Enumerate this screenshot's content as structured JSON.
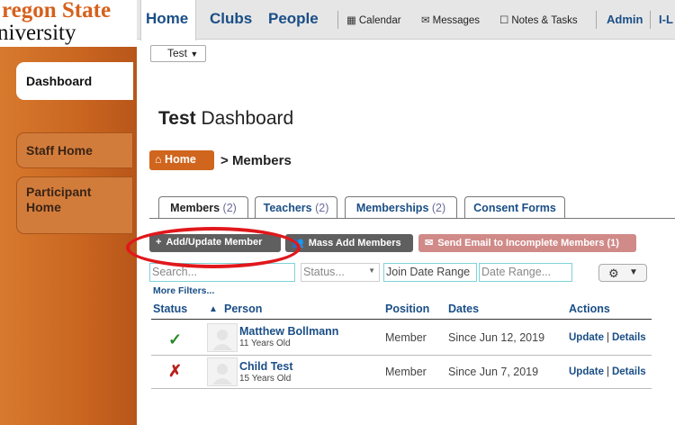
{
  "logo": {
    "line1": "regon State",
    "line2": "niversity"
  },
  "topnav": {
    "home": "Home",
    "clubs": "Clubs",
    "people": "People",
    "calendar": "Calendar",
    "messages": "Messages",
    "notes": "Notes & Tasks",
    "admin": "Admin",
    "overflow": "I-L"
  },
  "sidebar": {
    "items": [
      {
        "label": "Dashboard"
      },
      {
        "label": "Staff Home"
      },
      {
        "label": "Participant Home"
      }
    ]
  },
  "selector": {
    "value": "Test"
  },
  "page": {
    "title_bold": "Test",
    "title_rest": " Dashboard"
  },
  "breadcrumb": {
    "home": "Home",
    "current": "Members"
  },
  "tabs": [
    {
      "label": "Members",
      "count": "(2)"
    },
    {
      "label": "Teachers",
      "count": "(2)"
    },
    {
      "label": "Memberships",
      "count": "(2)"
    },
    {
      "label": "Consent Forms",
      "count": ""
    }
  ],
  "actions": {
    "add_update": "Add/Update Member",
    "mass_add": "Mass Add Members",
    "send_email": "Send Email to Incomplete Members (1)"
  },
  "filters": {
    "search_placeholder": "Search...",
    "status_placeholder": "Status...",
    "join_date_range": "Join Date Range",
    "date_range_placeholder": "Date Range...",
    "more_filters": "More Filters..."
  },
  "table": {
    "headers": {
      "status": "Status",
      "person": "Person",
      "position": "Position",
      "dates": "Dates",
      "actions": "Actions"
    },
    "rows": [
      {
        "status": "✓",
        "name": "Matthew Bollmann",
        "age": "11 Years Old",
        "position": "Member",
        "dates": "Since Jun 12, 2019",
        "update": "Update",
        "details": "Details"
      },
      {
        "status": "✗",
        "name": "Child Test",
        "age": "15 Years Old",
        "position": "Member",
        "dates": "Since Jun 7, 2019",
        "update": "Update",
        "details": "Details"
      }
    ]
  },
  "colors": {
    "brand_orange": "#d0651d",
    "link_blue": "#1a4e86",
    "check_green": "#2a8a2a",
    "x_red": "#b8201c",
    "highlight_circle": "#e0181c"
  }
}
